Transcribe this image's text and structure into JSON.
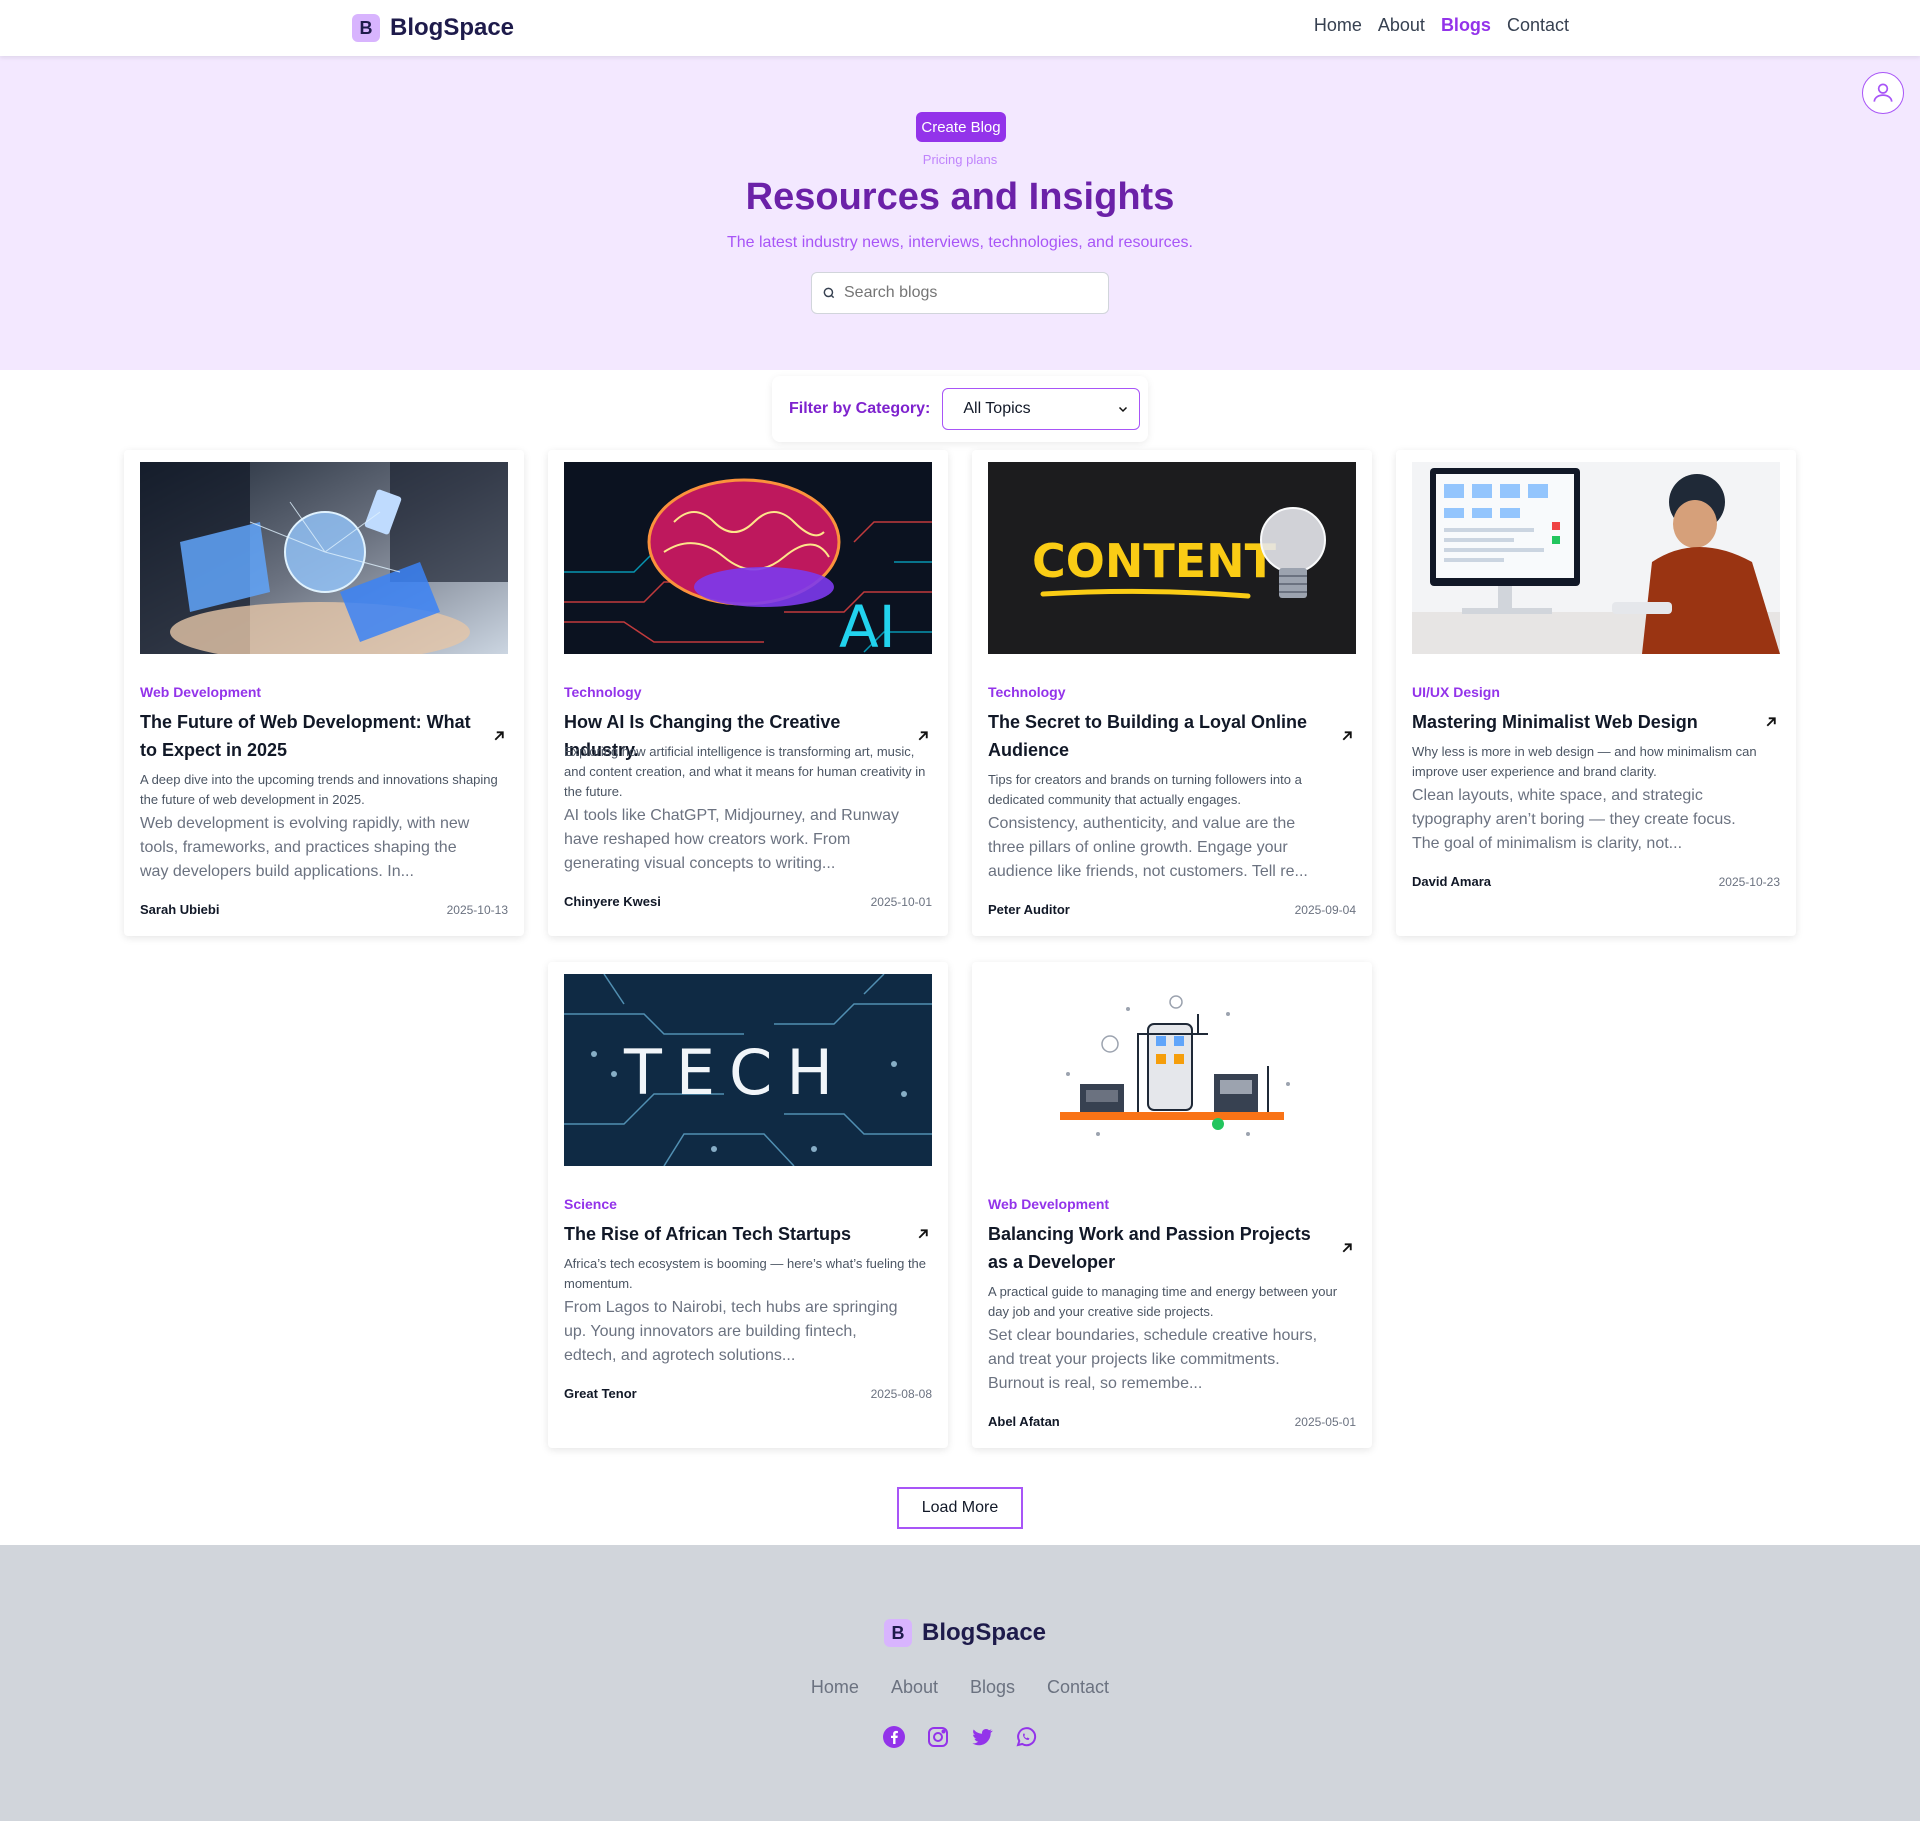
{
  "brand": {
    "badge": "B",
    "name": "BlogSpace"
  },
  "nav": {
    "links": [
      "Home",
      "About",
      "Blogs",
      "Contact"
    ],
    "active": "Blogs"
  },
  "hero": {
    "create_label": "Create Blog",
    "pricing_label": "Pricing plans",
    "title": "Resources and Insights",
    "subtitle": "The latest industry news, interviews, technologies, and resources.",
    "search_placeholder": "Search blogs"
  },
  "filter": {
    "label": "Filter by Category:",
    "selected": "All Topics"
  },
  "posts": [
    {
      "category": "Web Development",
      "title": "The Future of Web Development: What to Expect in 2025",
      "excerpt": "A deep dive into the upcoming trends and innovations shaping the future of web development in 2025.",
      "body": "Web development is evolving rapidly, with new tools, frameworks, and practices shaping the way developers build applications. In...",
      "author": "Sarah Ubiebi",
      "date": "2025-10-13",
      "image_icon": "tech-devices-image"
    },
    {
      "category": "Technology",
      "title": "How AI Is Changing the Creative Industry.",
      "excerpt": "Exploring how artificial intelligence is transforming art, music, and content creation, and what it means for human creativity in the future.",
      "body": "AI tools like ChatGPT, Midjourney, and Runway have reshaped how creators work. From generating visual concepts to writing...",
      "author": "Chinyere Kwesi",
      "date": "2025-10-01",
      "image_icon": "ai-brain-image",
      "image_text": "AI"
    },
    {
      "category": "Technology",
      "title": "The Secret to Building a Loyal Online Audience",
      "excerpt": "Tips for creators and brands on turning followers into a dedicated community that actually engages.",
      "body": "Consistency, authenticity, and value are the three pillars of online growth. Engage your audience like friends, not customers. Tell re...",
      "author": "Peter Auditor",
      "date": "2025-09-04",
      "image_icon": "content-lightbulb-image",
      "image_text": "CONTENT"
    },
    {
      "category": "UI/UX Design",
      "title": "Mastering Minimalist Web Design",
      "excerpt": "Why less is more in web design — and how minimalism can improve user experience and brand clarity.",
      "body": "Clean layouts, white space, and strategic typography aren’t boring — they create focus. The goal of minimalism is clarity, not...",
      "author": "David Amara",
      "date": "2025-10-23",
      "image_icon": "designer-desk-image"
    },
    {
      "category": "Science",
      "title": "The Rise of African Tech Startups",
      "excerpt": "Africa’s tech ecosystem is booming — here’s what’s fueling the momentum.",
      "body": "From Lagos to Nairobi, tech hubs are springing up. Young innovators are building fintech, edtech, and agrotech solutions...",
      "author": "Great Tenor",
      "date": "2025-08-08",
      "image_icon": "tech-circuit-image",
      "image_text": "TECH"
    },
    {
      "category": "Web Development",
      "title": "Balancing Work and Passion Projects as a Developer",
      "excerpt": "A practical guide to managing time and energy between your day job and your creative side projects.",
      "body": "Set clear boundaries, schedule creative hours, and treat your projects like commitments. Burnout is real, so remembe...",
      "author": "Abel Afatan",
      "date": "2025-05-01",
      "image_icon": "app-construction-illustration"
    }
  ],
  "load_more_label": "Load More",
  "footer": {
    "links": [
      "Home",
      "About",
      "Blogs",
      "Contact"
    ],
    "social": [
      "facebook-icon",
      "instagram-icon",
      "twitter-icon",
      "whatsapp-icon"
    ]
  },
  "colors": {
    "accent": "#9333ea",
    "hero_bg": "#f3e8ff",
    "footer_bg": "#d1d5db",
    "title": "#6b21a8"
  }
}
